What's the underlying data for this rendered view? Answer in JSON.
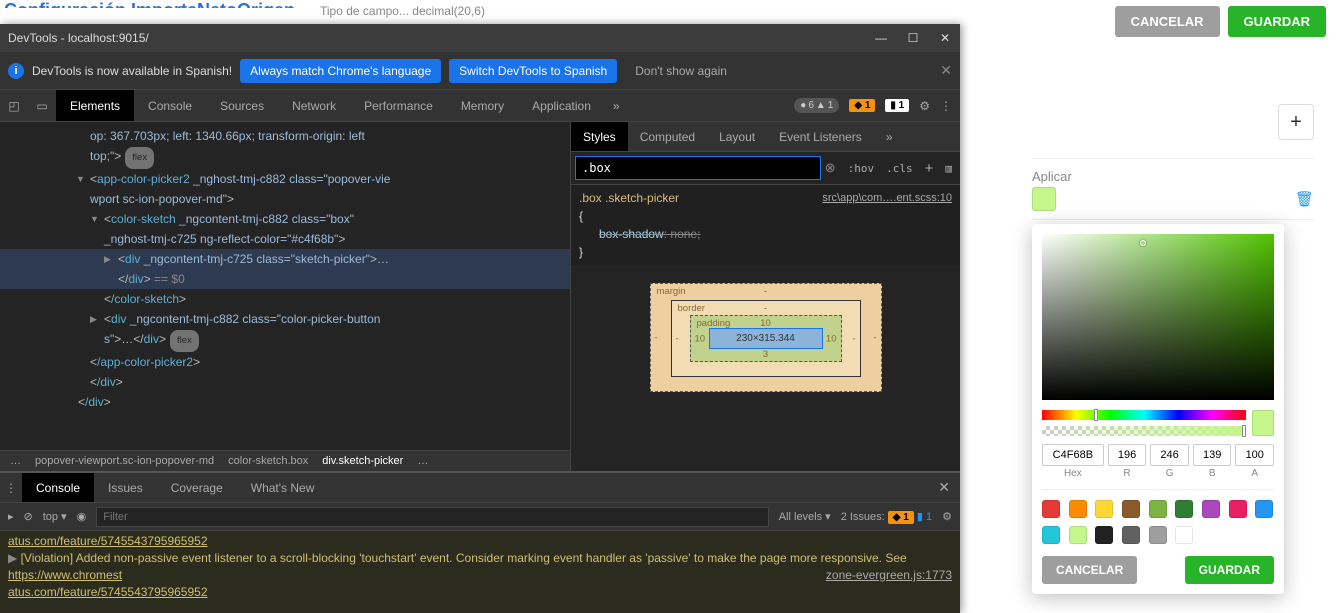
{
  "page": {
    "title_bg": "Configuración ImporteNetoOrigen",
    "type_hint": "Tipo de campo... decimal(20,6)",
    "cancel": "CANCELAR",
    "save": "GUARDAR",
    "apply": "Aplicar"
  },
  "picker": {
    "hex": "C4F68B",
    "r": "196",
    "g": "246",
    "b": "139",
    "a": "100",
    "labels": {
      "hex": "Hex",
      "r": "R",
      "g": "G",
      "b": "B",
      "a": "A"
    },
    "presets": [
      "#e53935",
      "#fb8c00",
      "#fdd835",
      "#8b5a2b",
      "#7cb342",
      "#2e7d32",
      "#ab47bc",
      "#e91e63",
      "#2196f3",
      "#26c6da",
      "#c4f68b",
      "#212121",
      "#616161",
      "#9e9e9e",
      "#ffffff"
    ],
    "cancel": "CANCELAR",
    "save": "GUARDAR"
  },
  "devtools": {
    "title": "DevTools - localhost:9015/",
    "lang_bar": {
      "msg": "DevTools is now available in Spanish!",
      "match": "Always match Chrome's language",
      "switch": "Switch DevTools to Spanish",
      "dont": "Don't show again"
    },
    "tabs": [
      "Elements",
      "Console",
      "Sources",
      "Network",
      "Performance",
      "Memory",
      "Application"
    ],
    "counts": {
      "dom": "6",
      "a11y": "1",
      "warn": "1",
      "info": "1"
    },
    "dom": {
      "l0a": "op: 367.703px; left: 1340.66px; transform-origin: left",
      "l0b": "top;",
      "flex": "flex",
      "appOpen": "app-color-picker2",
      "appAttrs": "_nghost-tmj-c882 class=\"popover-vie",
      "appLine2": "wport sc-ion-popover-md\"",
      "csOpen": "color-sketch",
      "csAttrs": "_ngcontent-tmj-c882 class=\"box\"",
      "csLine2": "_nghost-tmj-c725 ng-reflect-color=\"#c4f68b\"",
      "divSketch": "div",
      "divSketchAttrs": "_ngcontent-tmj-c725 class=\"sketch-picker\"",
      "eq0": "== $0",
      "csClose": "/color-sketch",
      "divBtn": "div",
      "divBtnAttrs": "_ngcontent-tmj-c882 class=\"color-picker-button",
      "divBtnLine2": "s\"",
      "appClose": "/app-color-picker2",
      "divClose": "/div"
    },
    "crumbs": [
      "…",
      "popover-viewport.sc-ion-popover-md",
      "color-sketch.box",
      "div.sketch-picker",
      "…"
    ],
    "styles": {
      "tabs": [
        "Styles",
        "Computed",
        "Layout",
        "Event Listeners"
      ],
      "filter": ".box",
      "hov": ":hov",
      "cls": ".cls",
      "rule_sel": ".box .sketch-picker",
      "rule_src": "src\\app\\com….ent.scss:10",
      "rule_prop": "box-shadow",
      "rule_val": "none",
      "box": {
        "margin": "margin",
        "border": "border",
        "padding": "padding",
        "pad_t": "10",
        "pad_l": "10",
        "pad_r": "10",
        "pad_b": "3",
        "content": "230×315.344"
      }
    },
    "drawer": {
      "tabs": [
        "Console",
        "Issues",
        "Coverage",
        "What's New"
      ],
      "top": "top",
      "filter_ph": "Filter",
      "levels": "All levels",
      "issues": "2 Issues:",
      "warn": "1",
      "info": "1",
      "link1": "atus.com/feature/5745543795965952",
      "msg1": "[Violation] Added non-passive event listener to a scroll-blocking 'touchstart' event. Consider marking event handler as 'passive' to make the page more responsive. See ",
      "msg_link": "https://www.chromest",
      "link2": "atus.com/feature/5745543795965952",
      "src": "zone-evergreen.js:1773"
    }
  }
}
